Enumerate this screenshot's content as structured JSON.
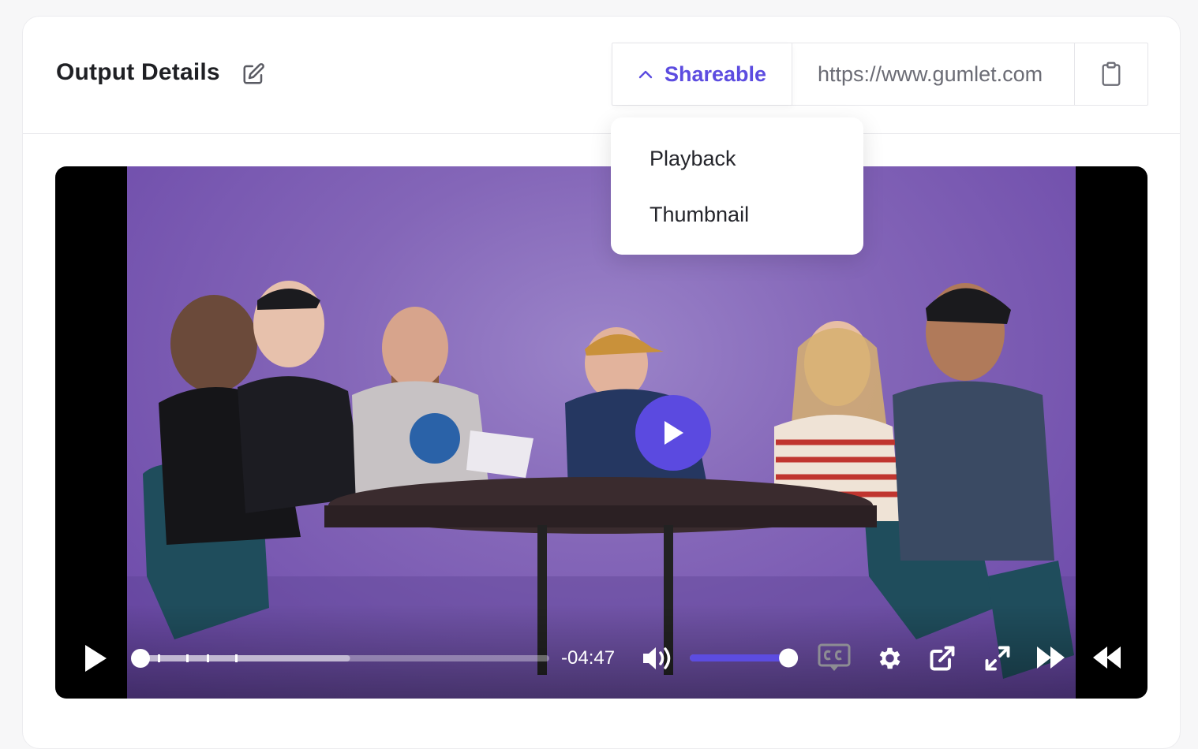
{
  "header": {
    "title": "Output Details"
  },
  "share": {
    "toggle_label": "Shareable",
    "url": "https://www.gumlet.com",
    "menu_items": [
      "Playback",
      "Thumbnail"
    ]
  },
  "player": {
    "time_remaining": "-04:47",
    "progress_fraction": 0.0,
    "buffered_fraction": 0.52,
    "volume_fraction": 0.92
  },
  "icons": [
    "edit-icon",
    "chevron-up-icon",
    "clipboard-icon",
    "play-icon",
    "volume-icon",
    "captions-icon",
    "gear-icon",
    "external-link-icon",
    "fullscreen-icon",
    "fast-forward-icon",
    "rewind-icon"
  ],
  "colors": {
    "accent": "#5c4ce0",
    "video_bg": "#8466b8"
  }
}
